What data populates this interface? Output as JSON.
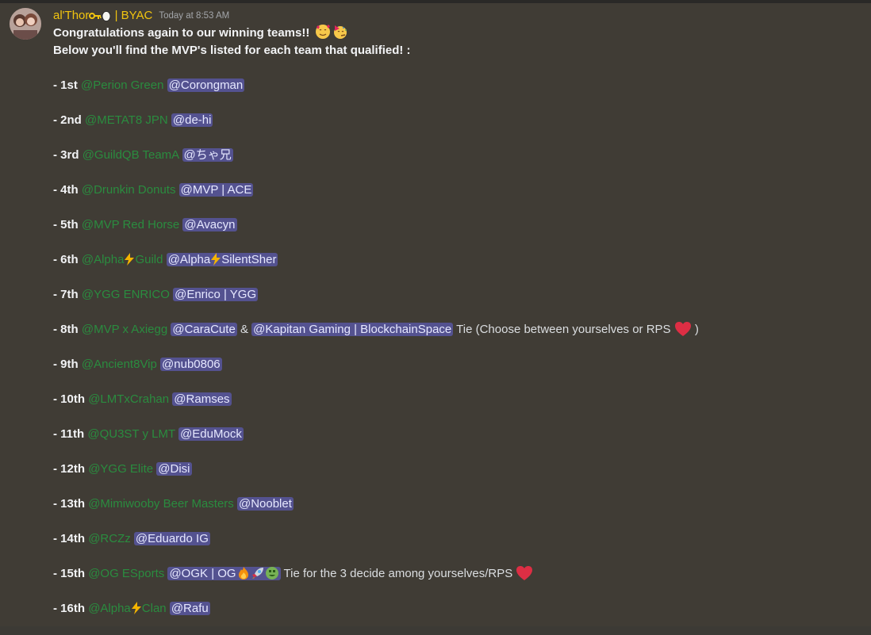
{
  "message": {
    "author": "al'Thor",
    "author_suffix": "| BYAC",
    "timestamp": "Today at 8:53 AM",
    "line1": "Congratulations again to our winning teams!!",
    "line2": "Below you'll find the MVP's listed for each team that qualified! :"
  },
  "rows": [
    {
      "rank": "- 1st",
      "role": "@Perion Green",
      "user": "@Corongman"
    },
    {
      "rank": "- 2nd",
      "role": "@METAT8 JPN",
      "user": "@de-hi"
    },
    {
      "rank": "- 3rd",
      "role": "@GuildQB TeamA",
      "user": "@ちゃ兄"
    },
    {
      "rank": "- 4th",
      "role": "@Drunkin Donuts",
      "user": "@MVP | ACE"
    },
    {
      "rank": "- 5th",
      "role": "@MVP Red Horse",
      "user": "@Avacyn"
    },
    {
      "rank": "- 6th",
      "role_a": "@Alpha",
      "role_b": "Guild",
      "user_a": "@Alpha",
      "user_b": "SilentSher"
    },
    {
      "rank": "- 7th",
      "role": "@YGG ENRICO",
      "user": "@Enrico | YGG"
    },
    {
      "rank": "- 8th",
      "role": "@MVP x Axiegg",
      "user": "@CaraCute",
      "amp": "&",
      "user2": "@Kapitan Gaming | BlockchainSpace",
      "note": "Tie (Choose between yourselves or RPS",
      "note_end": ")"
    },
    {
      "rank": "- 9th",
      "role": "@Ancient8Vip",
      "user": "@nub0806"
    },
    {
      "rank": "- 10th",
      "role": "@LMTxCrahan",
      "user": "@Ramses"
    },
    {
      "rank": "- 11th",
      "role": "@QU3ST y LMT",
      "user": "@EduMock"
    },
    {
      "rank": "- 12th",
      "role": "@YGG Elite",
      "user": "@Disi"
    },
    {
      "rank": "- 13th",
      "role": "@Mimiwooby Beer Masters",
      "user": "@Nooblet"
    },
    {
      "rank": "- 14th",
      "role": "@RCZz",
      "user": "@Eduardo IG"
    },
    {
      "rank": "- 15th",
      "role": "@OG ESports",
      "user": "@OGK | OG",
      "note": "Tie for the 3 decide among yourselves/RPS"
    },
    {
      "rank": "- 16th",
      "role_a": "@Alpha",
      "role_b": "Clan",
      "user": "@Rafu"
    }
  ],
  "colors": {
    "background": "#403c35",
    "username": "#f1c40f",
    "role_mention": "#2a8c3f",
    "user_mention_bg": "#545290"
  },
  "icons": [
    "key-icon",
    "egg-icon",
    "smiling-face-hearts-emoji",
    "partying-face-emoji",
    "lightning-bolt-emoji",
    "red-heart-emoji",
    "fire-emoji",
    "rocket-emoji",
    "money-mouth-emoji"
  ]
}
